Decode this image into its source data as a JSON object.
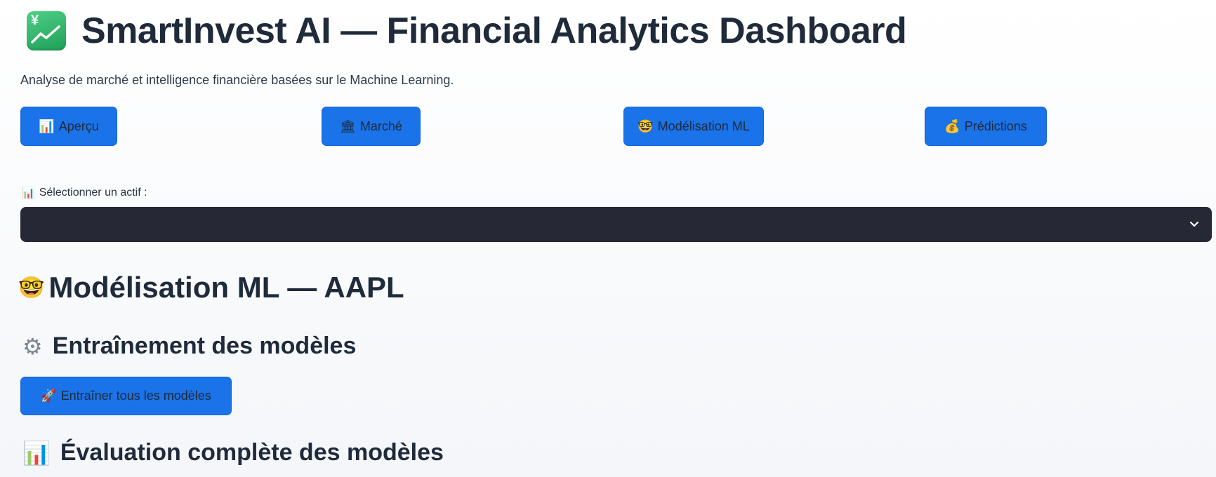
{
  "header": {
    "title": "SmartInvest AI — Financial Analytics Dashboard",
    "subtitle": "Analyse de marché et intelligence financière basées sur le Machine Learning."
  },
  "nav": {
    "buttons": [
      {
        "icon": "📊",
        "label": "Aperçu"
      },
      {
        "icon": "🏛",
        "label": "Marché"
      },
      {
        "icon": "🤓",
        "label": "Modélisation ML"
      },
      {
        "icon": "💰",
        "label": "Prédictions"
      }
    ]
  },
  "asset_select": {
    "icon": "📊",
    "label": "Sélectionner un actif :",
    "value": ""
  },
  "main": {
    "section_title": "Modélisation ML — AAPL",
    "section_icon": "🤓",
    "training": {
      "icon": "⚙",
      "title": "Entraînement des modèles",
      "button_icon": "🚀",
      "button_label": "Entraîner tous les modèles"
    },
    "evaluation": {
      "icon": "📊",
      "title": "Évaluation complète des modèles"
    }
  },
  "colors": {
    "accent": "#1a73e8",
    "text": "#1f2a3a",
    "select_bg": "#262935"
  }
}
